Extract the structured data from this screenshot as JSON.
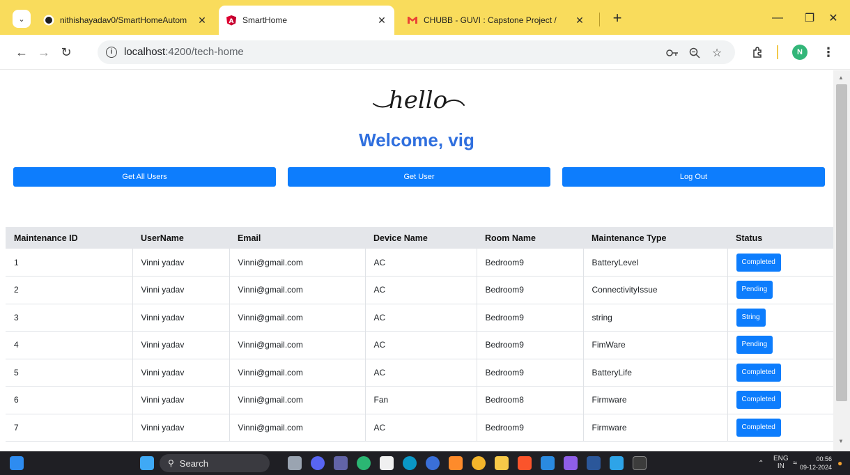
{
  "browser": {
    "tabs": [
      {
        "title": "nithishayadav0/SmartHomeAutom",
        "favicon": "github-icon",
        "active": false
      },
      {
        "title": "SmartHome",
        "favicon": "angular-icon",
        "active": true
      },
      {
        "title": "CHUBB - GUVI : Capstone Project /",
        "favicon": "gmail-icon",
        "active": false
      }
    ],
    "url_host": "localhost",
    "url_path": ":4200/tech-home",
    "profile_initial": "N"
  },
  "page": {
    "logo_text": "hello",
    "welcome": "Welcome, vig",
    "buttons": {
      "get_all_users": "Get All Users",
      "get_user": "Get User",
      "log_out": "Log Out"
    },
    "table": {
      "headers": [
        "Maintenance ID",
        "UserName",
        "Email",
        "Device Name",
        "Room Name",
        "Maintenance Type",
        "Status"
      ],
      "rows": [
        [
          "1",
          "Vinni yadav",
          "Vinni@gmail.com",
          "AC",
          "Bedroom9",
          "BatteryLevel",
          "Completed"
        ],
        [
          "2",
          "Vinni yadav",
          "Vinni@gmail.com",
          "AC",
          "Bedroom9",
          "ConnectivityIssue",
          "Pending"
        ],
        [
          "3",
          "Vinni yadav",
          "Vinni@gmail.com",
          "AC",
          "Bedroom9",
          "string",
          "String"
        ],
        [
          "4",
          "Vinni yadav",
          "Vinni@gmail.com",
          "AC",
          "Bedroom9",
          "FimWare",
          "Pending"
        ],
        [
          "5",
          "Vinni yadav",
          "Vinni@gmail.com",
          "AC",
          "Bedroom9",
          "BatteryLife",
          "Completed"
        ],
        [
          "6",
          "Vinni yadav",
          "Vinni@gmail.com",
          "Fan",
          "Bedroom8",
          "Firmware",
          "Completed"
        ],
        [
          "7",
          "Vinni yadav",
          "Vinni@gmail.com",
          "AC",
          "Bedroom9",
          "Firmware",
          "Completed"
        ]
      ]
    }
  },
  "taskbar": {
    "search_label": "Search",
    "lang_top": "ENG",
    "lang_bottom": "IN",
    "time": "00:56",
    "date": "09-12-2024"
  },
  "colors": {
    "tab_strip": "#f9dc5c",
    "primary_button": "#0d7dfd",
    "welcome_text": "#2f6fde"
  }
}
